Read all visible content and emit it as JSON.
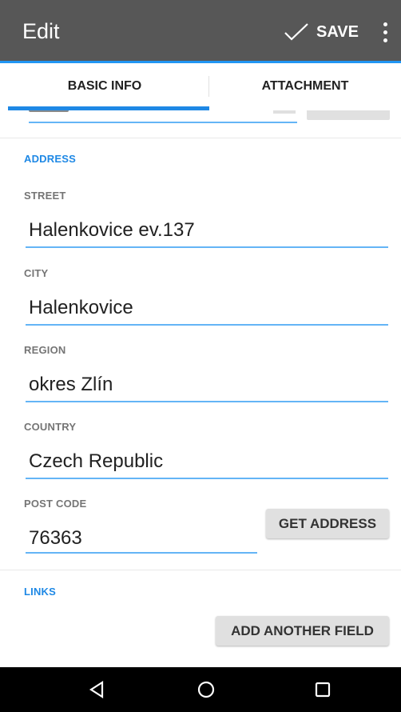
{
  "appbar": {
    "title": "Edit",
    "save_label": "SAVE",
    "accent_color": "#2196f3",
    "background": "#575757"
  },
  "tabs": [
    {
      "label": "BASIC INFO",
      "selected": true
    },
    {
      "label": "ATTACHMENT",
      "selected": false
    }
  ],
  "address": {
    "heading": "ADDRESS",
    "street": {
      "label": "STREET",
      "value": "Halenkovice ev.137"
    },
    "city": {
      "label": "CITY",
      "value": "Halenkovice"
    },
    "region": {
      "label": "REGION",
      "value": "okres Zlín"
    },
    "country": {
      "label": "COUNTRY",
      "value": "Czech Republic"
    },
    "post_code": {
      "label": "POST CODE",
      "value": "76363"
    },
    "get_address_label": "GET ADDRESS"
  },
  "links": {
    "heading": "LINKS",
    "add_field_label": "ADD ANOTHER FIELD"
  },
  "navbar": {
    "items": [
      "back-icon",
      "home-icon",
      "recents-icon"
    ]
  }
}
